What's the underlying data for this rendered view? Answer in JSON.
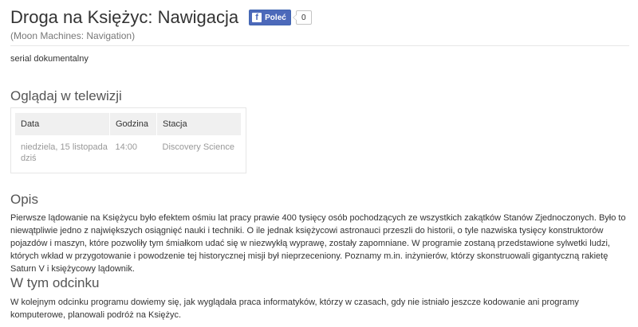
{
  "header": {
    "title": "Droga na Księżyc: Nawigacja",
    "subtitle": "(Moon Machines: Navigation)",
    "fb_like_label": "Poleć",
    "fb_like_count": "0"
  },
  "genre": "serial dokumentalny",
  "tv_section": {
    "heading": "Oglądaj w telewizji",
    "columns": [
      "Data",
      "Godzina",
      "Stacja"
    ],
    "rows": [
      {
        "date_line1": "niedziela, 15 listopada",
        "date_line2": "dziś",
        "time": "14:00",
        "station": "Discovery Science"
      }
    ]
  },
  "description": {
    "heading": "Opis",
    "text": "Pierwsze lądowanie na Księżycu było efektem ośmiu lat pracy prawie 400 tysięcy osób pochodzących ze wszystkich zakątków Stanów Zjednoczonych. Było to niewątpliwie jedno z największych osiągnięć nauki i techniki. O ile jednak księżycowi astronauci przeszli do historii, o tyle nazwiska tysięcy konstruktorów pojazdów i maszyn, które pozwoliły tym śmiałkom udać się w niezwykłą wyprawę, zostały zapomniane. W programie zostaną przedstawione sylwetki ludzi, których wkład w przygotowanie i powodzenie tej historycznej misji był nieprzeceniony. Poznamy m.in. inżynierów, którzy skonstruowali gigantyczną rakietę Saturn V i księżycowy lądownik."
  },
  "episode": {
    "heading": "W tym odcinku",
    "text": "W kolejnym odcinku programu dowiemy się, jak wyglądała praca informatyków, którzy w czasach, gdy nie istniało jeszcze kodowanie ani programy komputerowe, planowali podróż na Księżyc."
  }
}
